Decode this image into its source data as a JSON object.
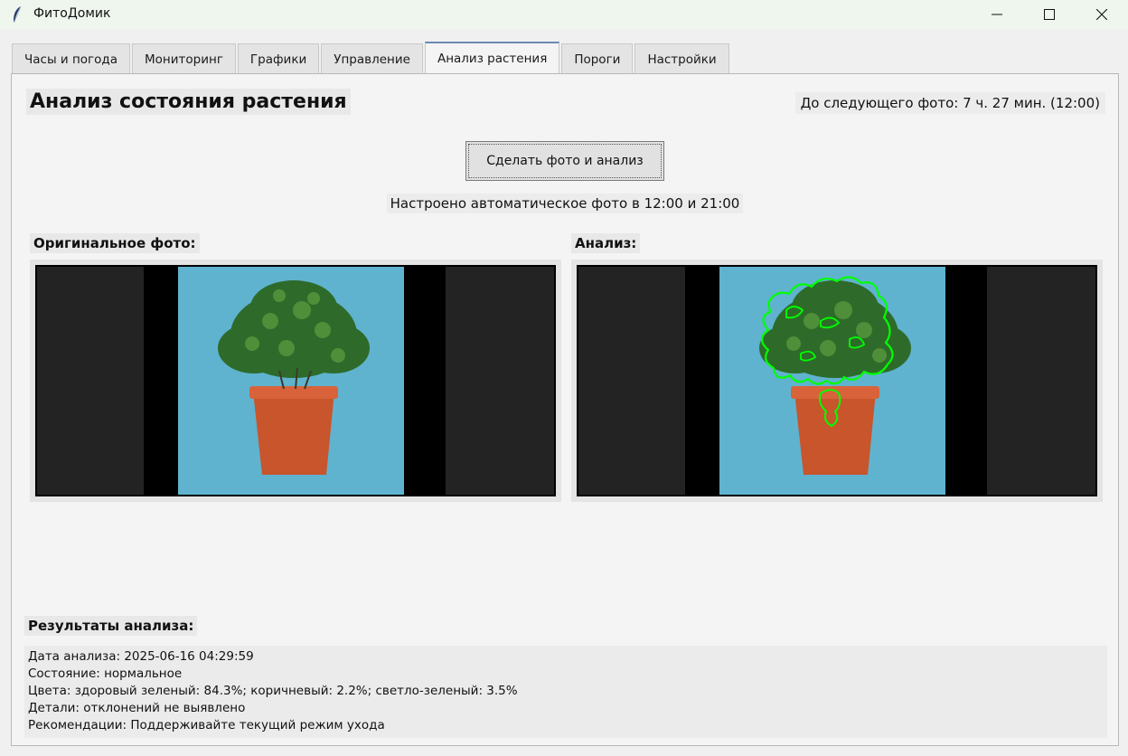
{
  "window": {
    "title": "ФитоДомик",
    "icon": "feather-icon"
  },
  "tabs": [
    {
      "label": "Часы и погода"
    },
    {
      "label": "Мониторинг"
    },
    {
      "label": "Графики"
    },
    {
      "label": "Управление"
    },
    {
      "label": "Анализ растения",
      "active": true
    },
    {
      "label": "Пороги"
    },
    {
      "label": "Настройки"
    }
  ],
  "analysis": {
    "heading": "Анализ состояния растения",
    "countdown": "До следующего фото: 7 ч. 27 мин. (12:00)",
    "capture_button": "Сделать фото и анализ",
    "schedule_note": "Настроено автоматическое фото в 12:00 и 21:00",
    "original_label": "Оригинальное фото:",
    "analysis_label": "Анализ:",
    "results_label": "Результаты анализа:",
    "results": [
      "Дата анализа: 2025-06-16 04:29:59",
      "Состояние: нормальное",
      "Цвета: здоровый зеленый: 84.3%; коричневый: 2.2%; светло-зеленый: 3.5%",
      "Детали: отклонений не выявлено",
      "Рекомендации: Поддерживайте текущий режим ухода"
    ]
  },
  "colors": {
    "photo_background": "#5fb3cf",
    "pot": "#c8552b",
    "foliage": "#2e6b2a",
    "contour": "#00ff00",
    "active_tab_accent": "#6b88b5"
  }
}
